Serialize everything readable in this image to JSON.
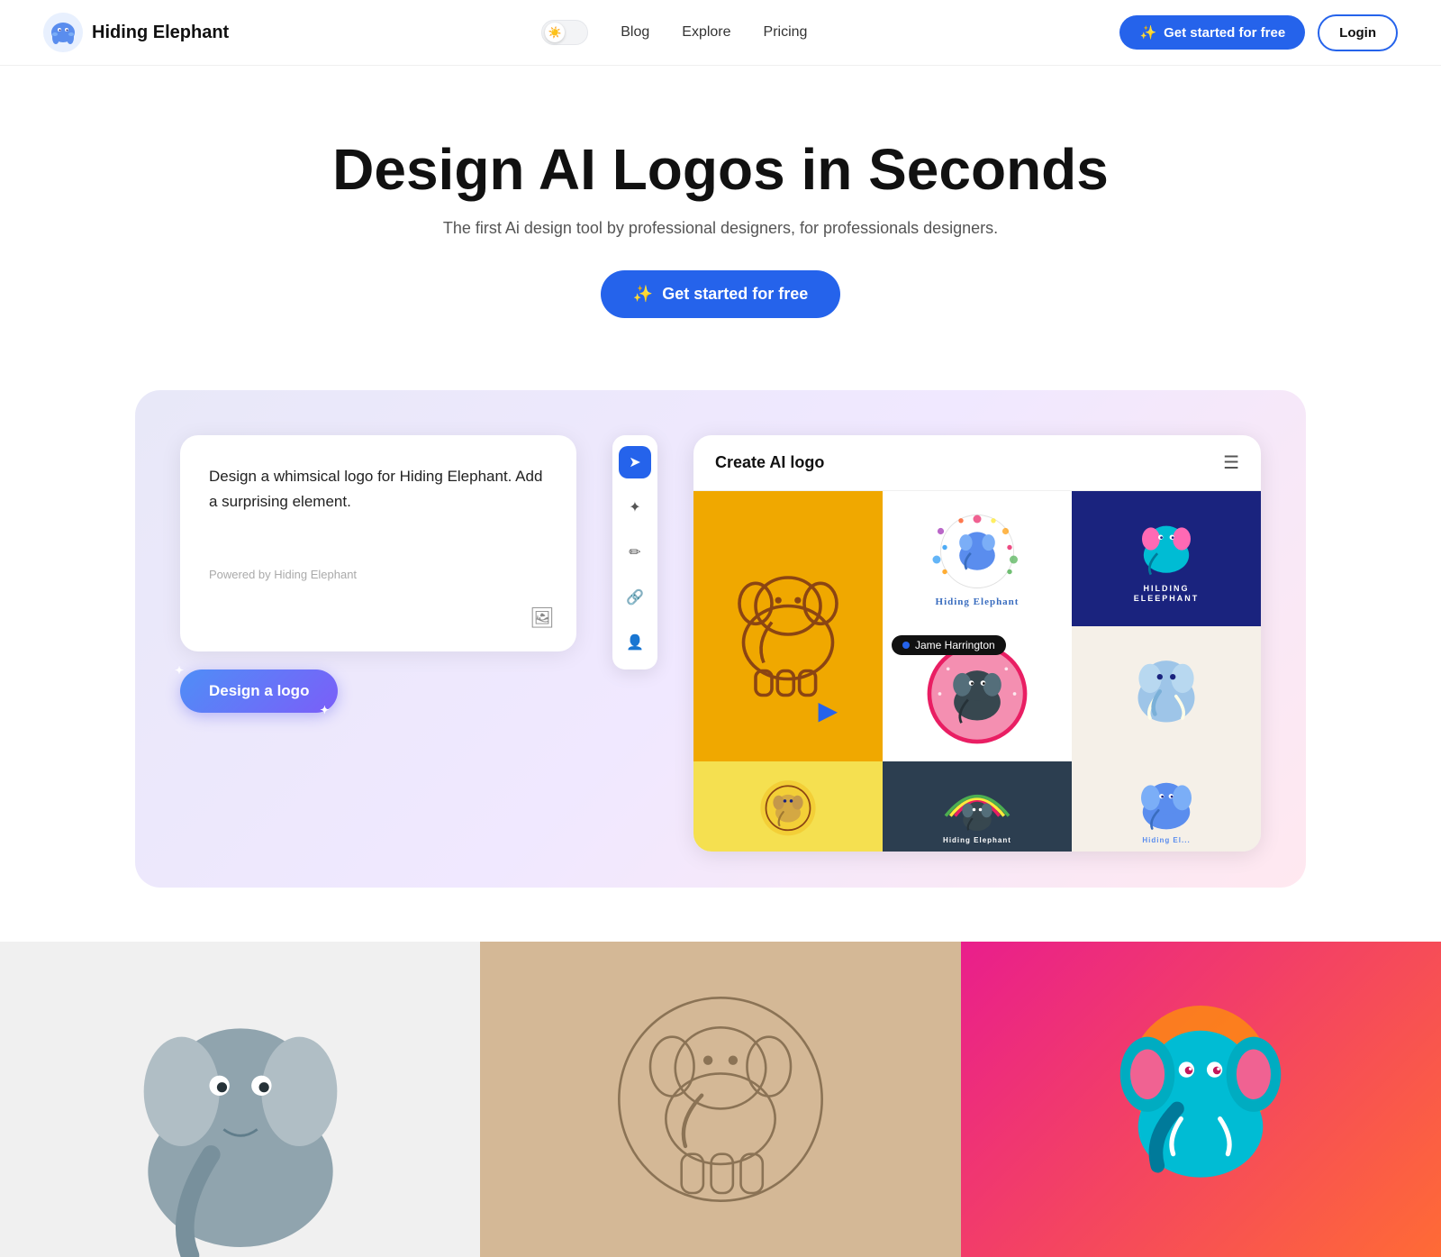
{
  "brand": {
    "name": "Hiding Elephant",
    "logo_emoji": "🐘"
  },
  "nav": {
    "blog": "Blog",
    "explore": "Explore",
    "pricing": "Pricing",
    "get_started": "Get started for free",
    "login": "Login",
    "theme_emoji": "☀️"
  },
  "hero": {
    "title": "Design AI Logos in Seconds",
    "subtitle": "The first Ai design tool by professional designers, for professionals designers.",
    "cta": "Get started for free",
    "cta_icon": "✨"
  },
  "demo": {
    "prompt_text": "Design a whimsical logo for Hiding Elephant. Add a surprising element.",
    "powered_by": "Powered by Hiding Elephant",
    "design_btn": "Design a logo",
    "panel_title": "Create AI logo",
    "user_name": "Jame Harrington",
    "toolbar": {
      "cursor": "➤",
      "wand": "✦",
      "pen": "✒",
      "link": "🔗",
      "person": "👤"
    }
  },
  "gallery": {
    "items": [
      {
        "id": "left",
        "description": "Grey elephant logo"
      },
      {
        "id": "mid",
        "description": "Outline elephant circle logo"
      },
      {
        "id": "right",
        "description": "Teal elephant on pink/orange gradient"
      }
    ]
  }
}
